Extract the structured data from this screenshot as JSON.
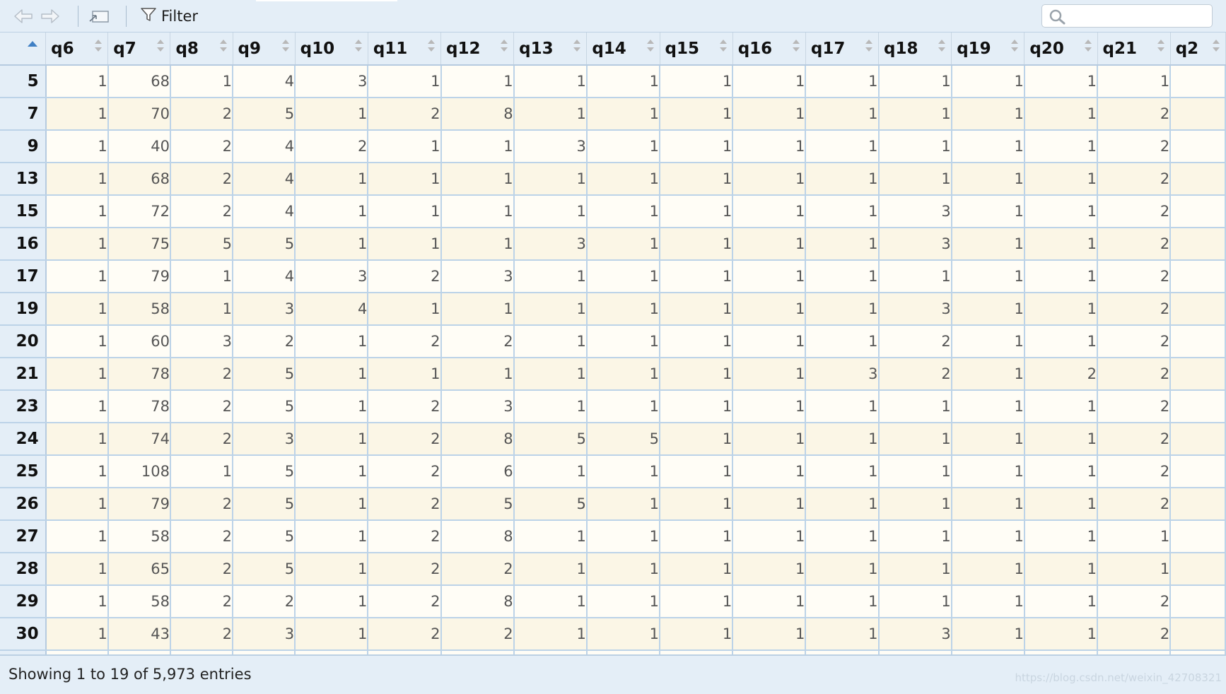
{
  "toolbar": {
    "back_icon": "arrow-left-icon",
    "forward_icon": "arrow-right-icon",
    "popout_icon": "popout-window-icon",
    "filter_icon": "funnel-icon",
    "filter_label": "Filter",
    "search_icon": "magnifier-icon",
    "search_value": ""
  },
  "grid": {
    "corner_sort": "ascending",
    "columns": [
      "q6",
      "q7",
      "q8",
      "q9",
      "q10",
      "q11",
      "q12",
      "q13",
      "q14",
      "q15",
      "q16",
      "q17",
      "q18",
      "q19",
      "q20",
      "q21",
      "q2"
    ],
    "rows": [
      {
        "id": "5",
        "cells": [
          "1",
          "68",
          "1",
          "4",
          "3",
          "1",
          "1",
          "1",
          "1",
          "1",
          "1",
          "1",
          "1",
          "1",
          "1",
          "1",
          ""
        ]
      },
      {
        "id": "7",
        "cells": [
          "1",
          "70",
          "2",
          "5",
          "1",
          "2",
          "8",
          "1",
          "1",
          "1",
          "1",
          "1",
          "1",
          "1",
          "1",
          "2",
          ""
        ]
      },
      {
        "id": "9",
        "cells": [
          "1",
          "40",
          "2",
          "4",
          "2",
          "1",
          "1",
          "3",
          "1",
          "1",
          "1",
          "1",
          "1",
          "1",
          "1",
          "2",
          ""
        ]
      },
      {
        "id": "13",
        "cells": [
          "1",
          "68",
          "2",
          "4",
          "1",
          "1",
          "1",
          "1",
          "1",
          "1",
          "1",
          "1",
          "1",
          "1",
          "1",
          "2",
          ""
        ]
      },
      {
        "id": "15",
        "cells": [
          "1",
          "72",
          "2",
          "4",
          "1",
          "1",
          "1",
          "1",
          "1",
          "1",
          "1",
          "1",
          "3",
          "1",
          "1",
          "2",
          ""
        ]
      },
      {
        "id": "16",
        "cells": [
          "1",
          "75",
          "5",
          "5",
          "1",
          "1",
          "1",
          "3",
          "1",
          "1",
          "1",
          "1",
          "3",
          "1",
          "1",
          "2",
          ""
        ]
      },
      {
        "id": "17",
        "cells": [
          "1",
          "79",
          "1",
          "4",
          "3",
          "2",
          "3",
          "1",
          "1",
          "1",
          "1",
          "1",
          "1",
          "1",
          "1",
          "2",
          ""
        ]
      },
      {
        "id": "19",
        "cells": [
          "1",
          "58",
          "1",
          "3",
          "4",
          "1",
          "1",
          "1",
          "1",
          "1",
          "1",
          "1",
          "3",
          "1",
          "1",
          "2",
          ""
        ]
      },
      {
        "id": "20",
        "cells": [
          "1",
          "60",
          "3",
          "2",
          "1",
          "2",
          "2",
          "1",
          "1",
          "1",
          "1",
          "1",
          "2",
          "1",
          "1",
          "2",
          ""
        ]
      },
      {
        "id": "21",
        "cells": [
          "1",
          "78",
          "2",
          "5",
          "1",
          "1",
          "1",
          "1",
          "1",
          "1",
          "1",
          "3",
          "2",
          "1",
          "2",
          "2",
          ""
        ]
      },
      {
        "id": "23",
        "cells": [
          "1",
          "78",
          "2",
          "5",
          "1",
          "2",
          "3",
          "1",
          "1",
          "1",
          "1",
          "1",
          "1",
          "1",
          "1",
          "2",
          ""
        ]
      },
      {
        "id": "24",
        "cells": [
          "1",
          "74",
          "2",
          "3",
          "1",
          "2",
          "8",
          "5",
          "5",
          "1",
          "1",
          "1",
          "1",
          "1",
          "1",
          "2",
          ""
        ]
      },
      {
        "id": "25",
        "cells": [
          "1",
          "108",
          "1",
          "5",
          "1",
          "2",
          "6",
          "1",
          "1",
          "1",
          "1",
          "1",
          "1",
          "1",
          "1",
          "2",
          ""
        ]
      },
      {
        "id": "26",
        "cells": [
          "1",
          "79",
          "2",
          "5",
          "1",
          "2",
          "5",
          "5",
          "1",
          "1",
          "1",
          "1",
          "1",
          "1",
          "1",
          "2",
          ""
        ]
      },
      {
        "id": "27",
        "cells": [
          "1",
          "58",
          "2",
          "5",
          "1",
          "2",
          "8",
          "1",
          "1",
          "1",
          "1",
          "1",
          "1",
          "1",
          "1",
          "1",
          ""
        ]
      },
      {
        "id": "28",
        "cells": [
          "1",
          "65",
          "2",
          "5",
          "1",
          "2",
          "2",
          "1",
          "1",
          "1",
          "1",
          "1",
          "1",
          "1",
          "1",
          "1",
          ""
        ]
      },
      {
        "id": "29",
        "cells": [
          "1",
          "58",
          "2",
          "2",
          "1",
          "2",
          "8",
          "1",
          "1",
          "1",
          "1",
          "1",
          "1",
          "1",
          "1",
          "2",
          ""
        ]
      },
      {
        "id": "30",
        "cells": [
          "1",
          "43",
          "2",
          "3",
          "1",
          "2",
          "2",
          "1",
          "1",
          "1",
          "1",
          "1",
          "3",
          "1",
          "1",
          "2",
          ""
        ]
      },
      {
        "id": "",
        "cells": [
          "",
          "",
          "",
          "",
          "",
          "",
          "",
          "",
          "",
          "",
          "",
          "",
          "",
          "",
          "",
          "",
          ""
        ]
      }
    ]
  },
  "footer": {
    "status": "Showing 1 to 19 of 5,973 entries",
    "watermark": "https://blog.csdn.net/weixin_42708321"
  },
  "colors": {
    "header_bg": "#e4eef7",
    "row_odd": "#fffdf6",
    "row_even": "#fbf6e6",
    "grid_line": "#bcd3e8",
    "sort_accent": "#3f7fc4"
  }
}
